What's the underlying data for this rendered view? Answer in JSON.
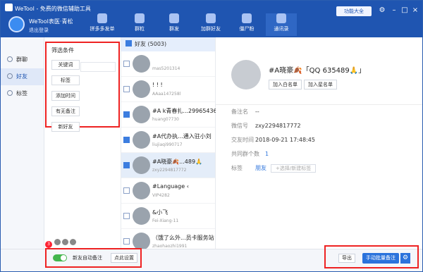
{
  "app": {
    "title": "WeTool - 免费的微信辅助工具",
    "user": "WeTool表医·青松",
    "logout": "退出登录",
    "update": "功能大全"
  },
  "nav": [
    {
      "label": "拼多多发单"
    },
    {
      "label": "群粒"
    },
    {
      "label": "群发"
    },
    {
      "label": "加群好友"
    },
    {
      "label": "僵尸粉"
    },
    {
      "label": "通讯录"
    }
  ],
  "leftnav": [
    {
      "label": "群聊"
    },
    {
      "label": "好友"
    },
    {
      "label": "标签"
    }
  ],
  "filter": {
    "title": "筛选条件",
    "buttons": [
      "关键词",
      "标签",
      "添加时间",
      "有无备注",
      "新好友"
    ]
  },
  "friends": {
    "header": "好友 (5003)",
    "items": [
      {
        "name": "",
        "id": "mas5201314"
      },
      {
        "name": "! ! !",
        "id": "AAaa147258l"
      },
      {
        "name": "#A  k青春扎...29965436",
        "id": "huang07730"
      },
      {
        "name": "#A代办执...通入驻小刘",
        "id": "liujiaqi990717"
      },
      {
        "name": "#A晓豪🍂...489🙏",
        "id": "zxy2294817772"
      },
      {
        "name": "#Language  ‹",
        "id": "VIP4282"
      },
      {
        "name": "&小飞",
        "id": "Fei-Xiang-11"
      },
      {
        "name": "（饿了么外...员卡服务站",
        "id": "zhaohaozhi1991"
      }
    ]
  },
  "detail": {
    "name": "#A晓豪🍂「QQ 635489🙏」",
    "btn_blacklist": "加入白名单",
    "btn_star": "加入星名单",
    "remark_label": "备注名",
    "remark": "--",
    "wx_label": "微信号",
    "wx": "zxy2294817772",
    "time_label": "交友时间",
    "time": "2018-09-21 17:48:45",
    "groups_label": "共同群个数",
    "groups": "1",
    "tags_label": "标签",
    "tag": "朋友",
    "tag_placeholder": "+选择/新建标签"
  },
  "footer": {
    "badge": "3",
    "toggle_label": "新友自动备注",
    "settings": "点此设置",
    "export": "导出",
    "batch": "手动批量备注"
  }
}
